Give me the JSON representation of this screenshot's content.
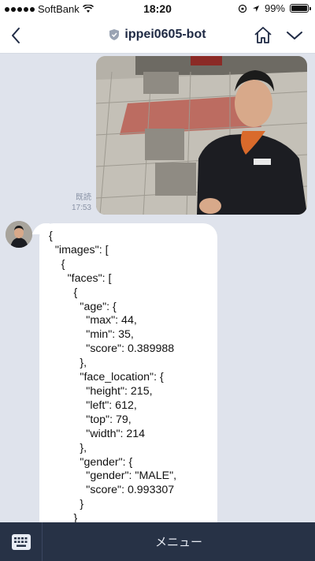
{
  "status_bar": {
    "carrier": "SoftBank",
    "time": "18:20",
    "battery_percent_text": "99%",
    "battery_level": 0.99
  },
  "header": {
    "title": "ippei0605-bot",
    "back_icon": "chevron-left-icon",
    "home_icon": "home-icon",
    "dropdown_icon": "chevron-down-icon",
    "verified_icon": "shield-icon"
  },
  "messages": {
    "sent_photo": {
      "read_label": "既読",
      "timestamp": "17:53"
    },
    "bot_reply": {
      "lines": [
        "{",
        "  \"images\": [",
        "    {",
        "      \"faces\": [",
        "        {",
        "          \"age\": {",
        "            \"max\": 44,",
        "            \"min\": 35,",
        "            \"score\": 0.389988",
        "          },",
        "          \"face_location\": {",
        "            \"height\": 215,",
        "            \"left\": 612,",
        "            \"top\": 79,",
        "            \"width\": 214",
        "          },",
        "          \"gender\": {",
        "            \"gender\": \"MALE\",",
        "            \"score\": 0.993307",
        "          }",
        "        }"
      ]
    }
  },
  "bottom_bar": {
    "menu_label": "メニュー",
    "keyboard_icon": "keyboard-icon"
  },
  "colors": {
    "chat_background": "#dfe3ec",
    "bottom_bar": "#273246",
    "title": "#1f2a44"
  }
}
